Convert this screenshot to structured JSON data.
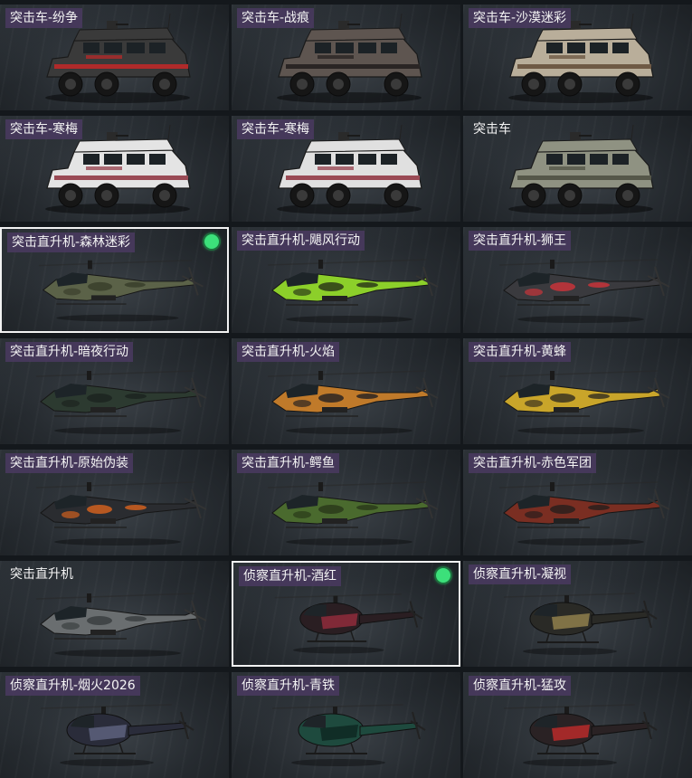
{
  "vehicles": [
    {
      "label": "突击车-纷争",
      "kind": "car",
      "skin": "#3a3a3a",
      "accent": "#b02a2a",
      "selected": false
    },
    {
      "label": "突击车-战痕",
      "kind": "car",
      "skin": "#5e5550",
      "accent": "#2a2524",
      "selected": false
    },
    {
      "label": "突击车-沙漠迷彩",
      "kind": "car",
      "skin": "#b9ae9a",
      "accent": "#6f5a45",
      "selected": false
    },
    {
      "label": "突击车-寒梅",
      "kind": "car",
      "skin": "#e4e4e4",
      "accent": "#9a4a55",
      "selected": false
    },
    {
      "label": "突击车-寒梅",
      "kind": "car",
      "skin": "#e0e0e0",
      "accent": "#9a4a55",
      "selected": false
    },
    {
      "label": "突击车",
      "kind": "car",
      "skin": "#8f9282",
      "accent": "#555749",
      "selected": false
    },
    {
      "label": "突击直升机-森林迷彩",
      "kind": "heli",
      "skin": "#5b6248",
      "accent": "#3a3f2c",
      "selected": true
    },
    {
      "label": "突击直升机-飓风行动",
      "kind": "heli",
      "skin": "#8ccf2a",
      "accent": "#2b3a18",
      "selected": false
    },
    {
      "label": "突击直升机-狮王",
      "kind": "heli",
      "skin": "#3a3a3e",
      "accent": "#c8343a",
      "selected": false
    },
    {
      "label": "突击直升机-暗夜行动",
      "kind": "heli",
      "skin": "#2c3a30",
      "accent": "#1c2420",
      "selected": false
    },
    {
      "label": "突击直升机-火焰",
      "kind": "heli",
      "skin": "#c07a2a",
      "accent": "#2a2422",
      "selected": false
    },
    {
      "label": "突击直升机-黄蜂",
      "kind": "heli",
      "skin": "#c9a52a",
      "accent": "#3a3220",
      "selected": false
    },
    {
      "label": "突击直升机-原始伪装",
      "kind": "heli",
      "skin": "#2a2c30",
      "accent": "#d0601e",
      "selected": false
    },
    {
      "label": "突击直升机-鳄鱼",
      "kind": "heli",
      "skin": "#4a6a2e",
      "accent": "#2a3a1a",
      "selected": false
    },
    {
      "label": "突击直升机-赤色军团",
      "kind": "heli",
      "skin": "#7a2e22",
      "accent": "#2a1e1c",
      "selected": false
    },
    {
      "label": "突击直升机",
      "kind": "heli",
      "skin": "#6a6e70",
      "accent": "#3a3e40",
      "selected": false
    },
    {
      "label": "侦察直升机-酒红",
      "kind": "scout",
      "skin": "#2a1e22",
      "accent": "#8a2a3a",
      "selected": true
    },
    {
      "label": "侦察直升机-凝视",
      "kind": "scout",
      "skin": "#2a2a26",
      "accent": "#8a7a4a",
      "selected": false
    },
    {
      "label": "侦察直升机-烟火2026",
      "kind": "scout",
      "skin": "#2a2c3a",
      "accent": "#5a5e7a",
      "selected": false
    },
    {
      "label": "侦察直升机-青铁",
      "kind": "scout",
      "skin": "#1e4a3e",
      "accent": "#0e2a24",
      "selected": false
    },
    {
      "label": "侦察直升机-猛攻",
      "kind": "scout",
      "skin": "#2a2224",
      "accent": "#b02a2a",
      "selected": false
    }
  ]
}
